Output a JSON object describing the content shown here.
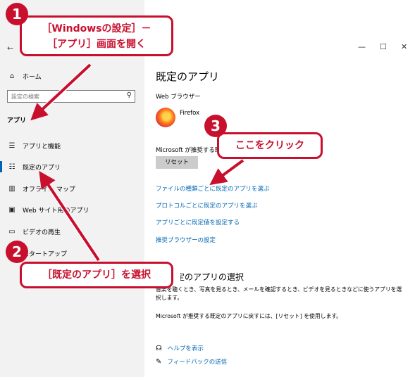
{
  "window": {
    "minimize": "—",
    "maximize": "☐",
    "close": "✕",
    "back": "←"
  },
  "sidebar": {
    "home": "ホーム",
    "search_placeholder": "設定の検索",
    "section": "アプリ",
    "items": [
      {
        "label": "アプリと機能"
      },
      {
        "label": "既定のアプリ"
      },
      {
        "label": "オフライン マップ"
      },
      {
        "label": "Web サイト用のアプリ"
      },
      {
        "label": "ビデオの再生"
      },
      {
        "label": "スタートアップ"
      }
    ]
  },
  "main": {
    "title": "既定のアプリ",
    "browser_heading": "Web ブラウザー",
    "browser_name": "Firefox",
    "reset_text": "Microsoft が推奨する既定値にリセットする",
    "reset_button": "リセット",
    "links": [
      "ファイルの種類ごとに既定のアプリを選ぶ",
      "プロトコルごとに既定のアプリを選ぶ",
      "アプリごとに既定値を設定する",
      "推奨ブラウザーの設定"
    ],
    "choose_heading": "既定のアプリの選択",
    "choose_desc": "音楽を聴くとき、写真を見るとき、メールを確認するとき、ビデオを見るときなどに使うアプリを選択します。",
    "reset_desc": "Microsoft が推奨する既定のアプリに戻すには、[リセット] を使用します。",
    "help": "ヘルプを表示",
    "feedback": "フィードバックの送信"
  },
  "callouts": {
    "c1_num": "1",
    "c1_line1": "［Windowsの設定］－",
    "c1_line2": "［アプリ］画面を開く",
    "c2_num": "2",
    "c2_text": "［既定のアプリ］を選択",
    "c3_num": "3",
    "c3_text": "ここをクリック"
  },
  "colors": {
    "accent": "#c8102e",
    "link": "#0066b4",
    "selected": "#0063b1"
  }
}
